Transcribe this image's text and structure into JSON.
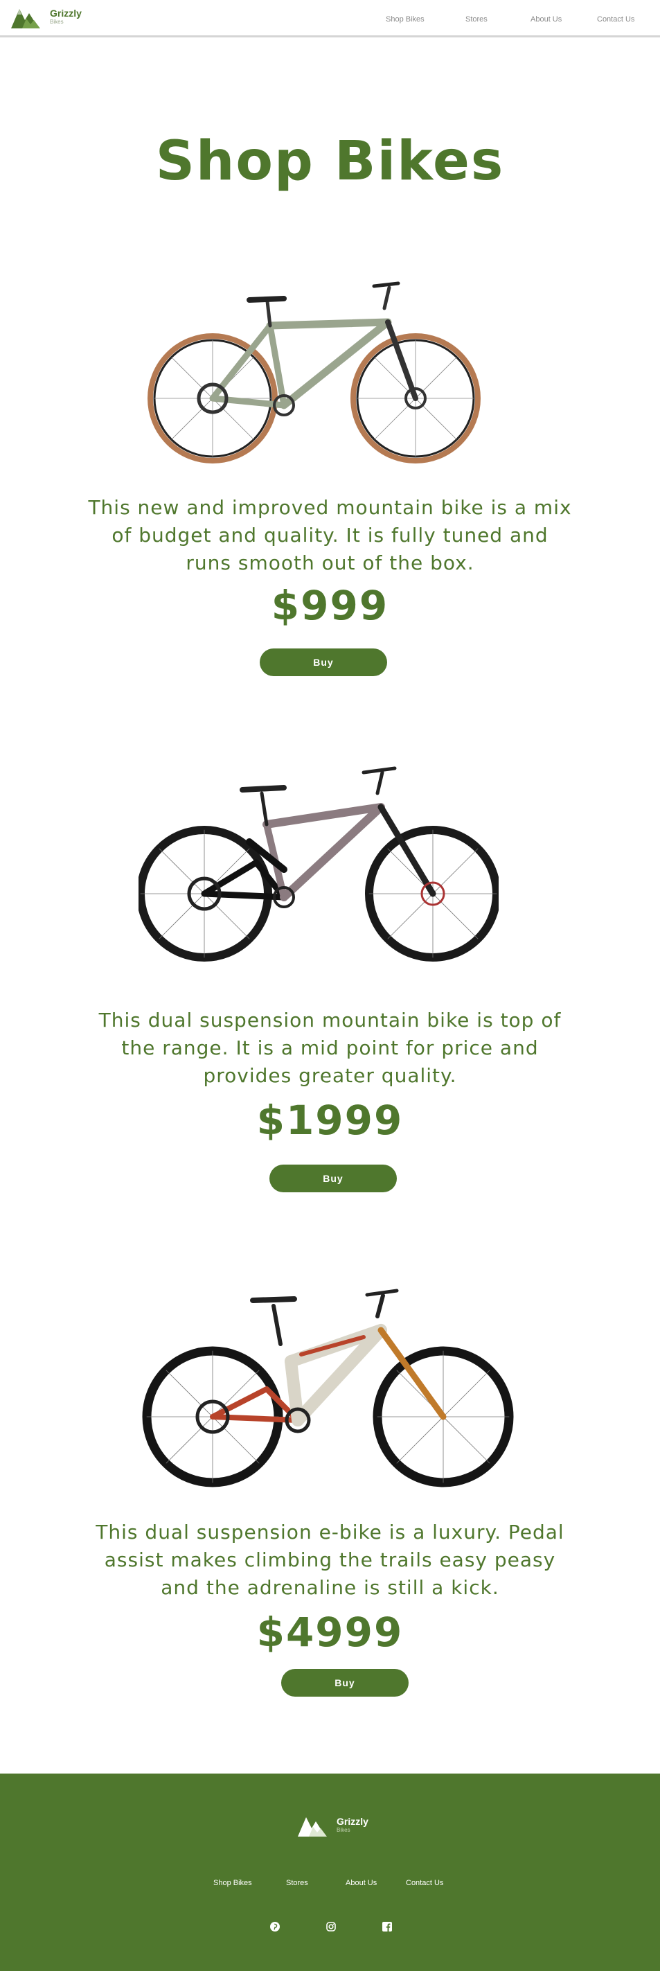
{
  "header": {
    "brand_name": "Grizzly",
    "brand_sub": "Bikes",
    "nav": [
      "Shop Bikes",
      "Stores",
      "About Us",
      "Contact Us"
    ]
  },
  "main": {
    "title": "Shop Bikes",
    "products": [
      {
        "description_lines": [
          "This new and improved mountain bike is a mix",
          "of budget and quality. It is fully tuned and",
          "runs smooth out of the box."
        ],
        "price": "$999",
        "buy_label": "Buy"
      },
      {
        "description_lines": [
          "This dual suspension mountain bike is top of",
          "the range. It is a mid point for price and",
          "provides greater quality."
        ],
        "price": "$1999",
        "buy_label": "Buy"
      },
      {
        "description_lines": [
          "This dual suspension e-bike is a luxury. Pedal",
          "assist makes climbing the trails easy peasy",
          "and the adrenaline is still a kick."
        ],
        "price": "$4999",
        "buy_label": "Buy"
      }
    ]
  },
  "footer": {
    "brand_name": "Grizzly",
    "brand_sub": "Bikes",
    "nav": [
      "Shop Bikes",
      "Stores",
      "About Us",
      "Contact Us"
    ],
    "social_icons": [
      "pinterest-icon",
      "instagram-icon",
      "facebook-icon"
    ]
  },
  "colors": {
    "brand_green": "#4f772d",
    "nav_gray": "#8a8a8a",
    "background": "#ffffff"
  }
}
